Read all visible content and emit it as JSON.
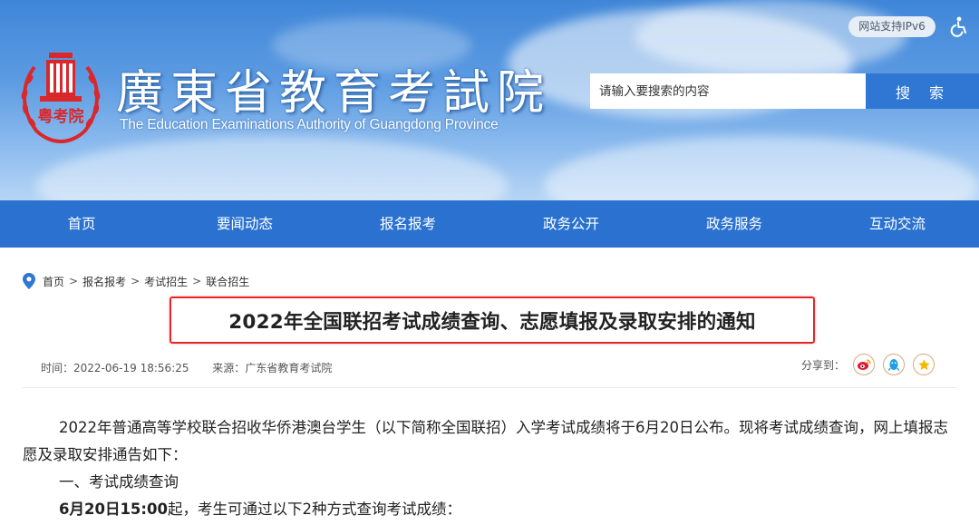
{
  "header": {
    "logo_cn": "廣東省教育考試院",
    "logo_en": "The Education Examinations Authority of Guangdong Province",
    "ipv6_badge": "网站支持IPv6",
    "search_placeholder": "请输入要搜索的内容",
    "search_button": "搜 索",
    "accessibility_icon": "wheelchair-icon",
    "logo_seal_text": "粤考院"
  },
  "nav": {
    "items": [
      {
        "label": "首页"
      },
      {
        "label": "要闻动态"
      },
      {
        "label": "报名报考"
      },
      {
        "label": "政务公开"
      },
      {
        "label": "政务服务"
      },
      {
        "label": "互动交流"
      }
    ]
  },
  "breadcrumb": {
    "items": [
      "首页",
      "报名报考",
      "考试招生",
      "联合招生"
    ],
    "separator": ">",
    "icon": "location-pin-icon"
  },
  "article": {
    "title": "2022年全国联招考试成绩查询、志愿填报及录取安排的通知",
    "time_label": "时间：",
    "time": "2022-06-19 18:56:25",
    "source_label": "来源：",
    "source": "广东省教育考试院",
    "share_label": "分享到：",
    "share_icons": [
      "weibo-icon",
      "qq-icon",
      "qzone-icon"
    ],
    "paragraphs": {
      "p1": "2022年普通高等学校联合招收华侨港澳台学生（以下简称全国联招）入学考试成绩将于6月20日公布。现将考试成绩查询，网上填报志愿及录取安排通告如下：",
      "p2": "一、考试成绩查询",
      "p3_bold": "6月20日15:00",
      "p3_rest": "起，考生可通过以下2种方式查询考试成绩："
    }
  },
  "colors": {
    "nav_bg": "#2b72d0",
    "search_button_bg": "#2f77d3",
    "title_border": "#e4262a",
    "logo_red": "#d9282c",
    "share_border": "#d7a77b"
  }
}
